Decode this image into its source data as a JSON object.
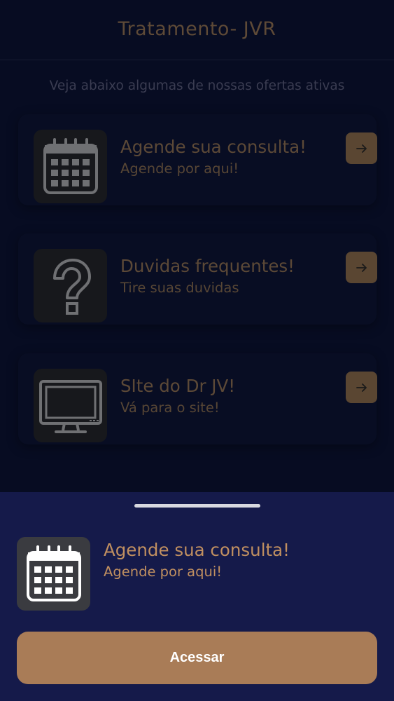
{
  "header": {
    "title": "Tratamento- JVR"
  },
  "intro": "Veja abaixo algumas de nossas ofertas ativas",
  "offers": [
    {
      "title": "Agende sua consulta!",
      "subtitle": "Agende por aqui!",
      "icon": "calendar-icon"
    },
    {
      "title": "Duvidas frequentes!",
      "subtitle": "Tire suas duvidas",
      "icon": "question-icon"
    },
    {
      "title": "SIte do Dr JV!",
      "subtitle": "Vá para o site!",
      "icon": "monitor-icon"
    }
  ],
  "sheet": {
    "title": "Agende sua consulta!",
    "subtitle": "Agende por aqui!",
    "icon": "calendar-icon",
    "button_label": "Acessar"
  },
  "colors": {
    "background": "#070c22",
    "accent": "#a97c57",
    "sheet_background": "#151a4a",
    "sheet_text": "#c08f60"
  }
}
